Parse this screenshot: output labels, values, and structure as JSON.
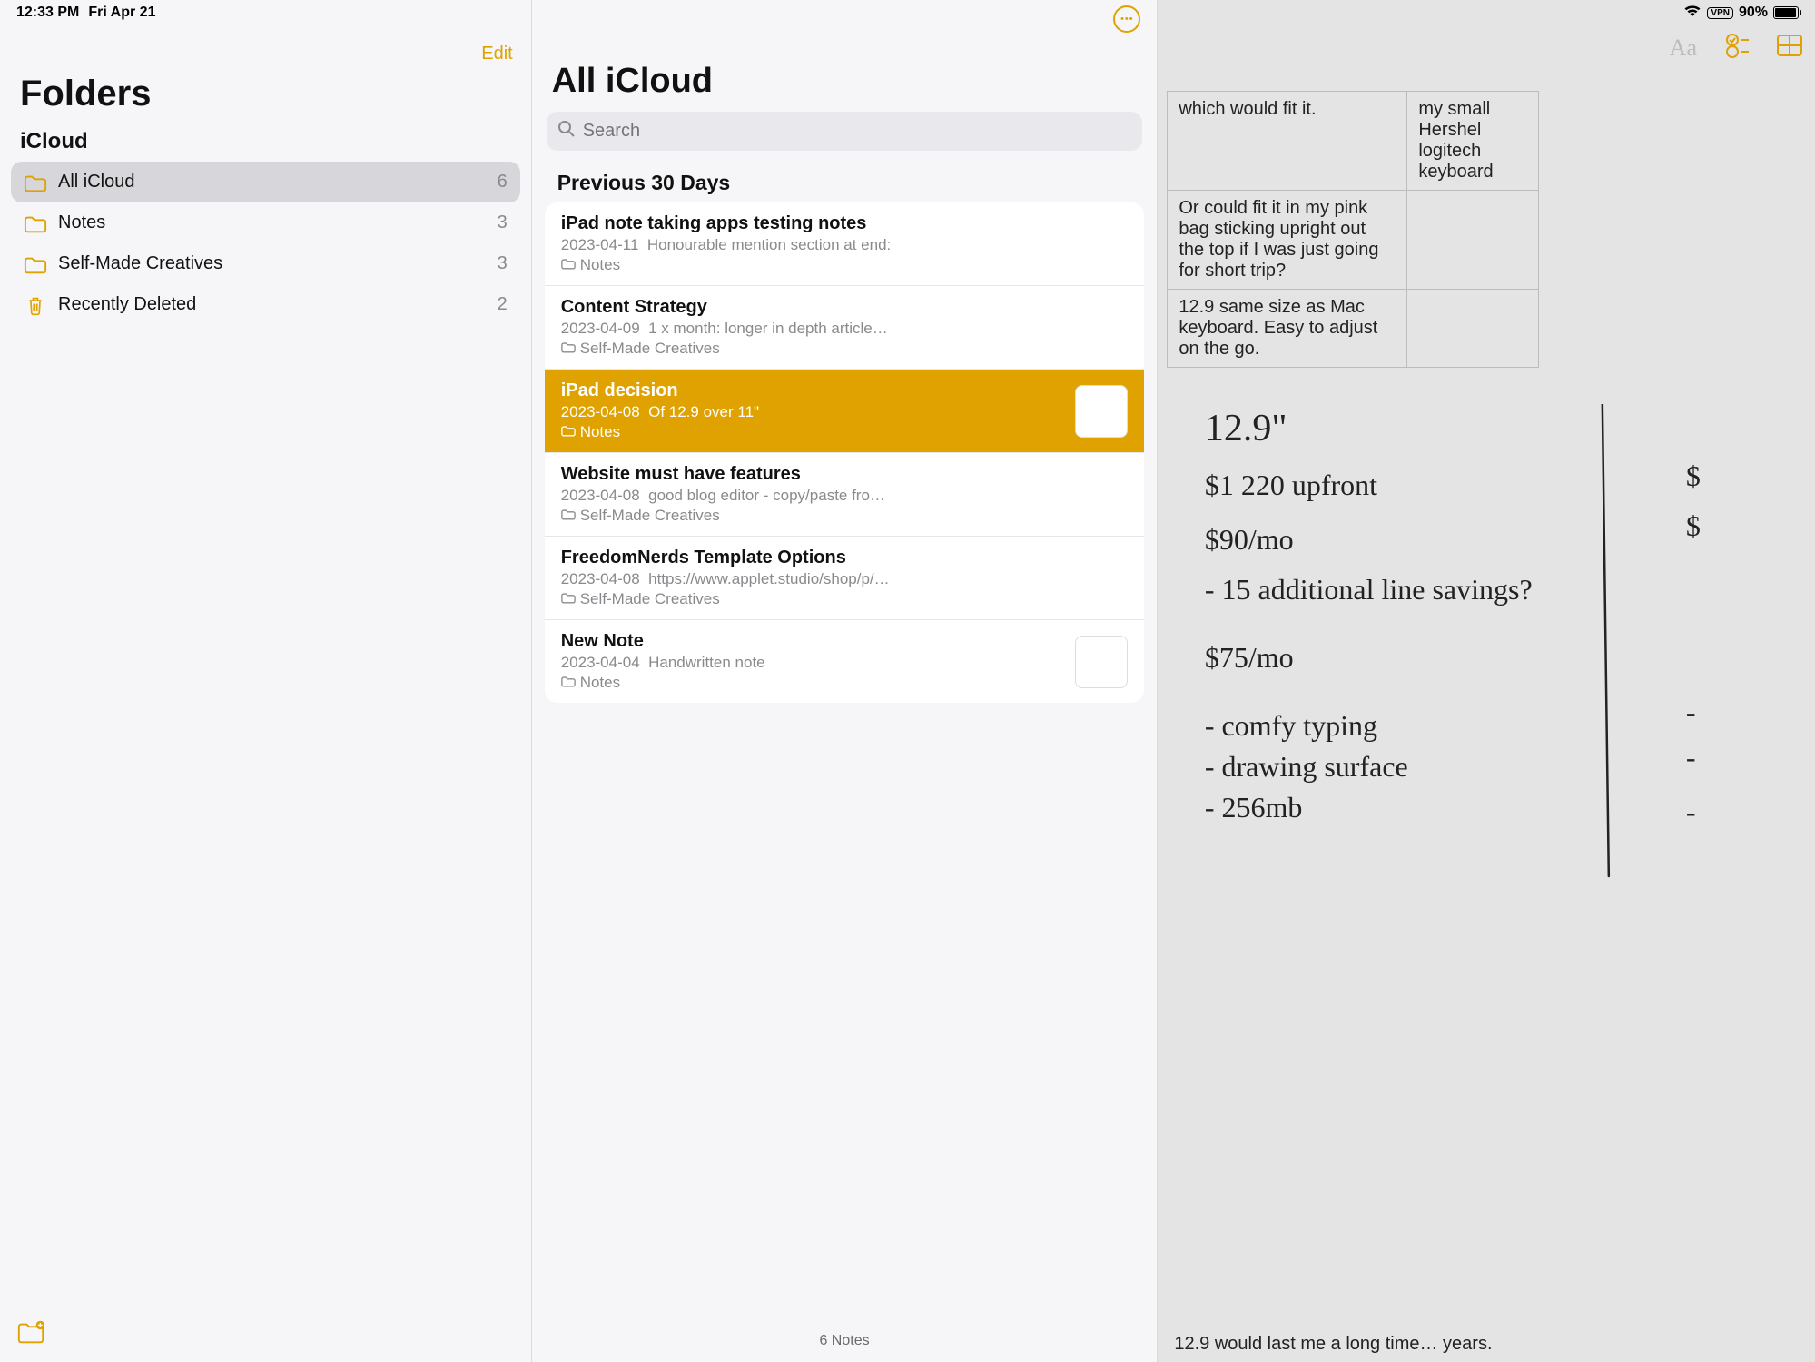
{
  "statusbar": {
    "time": "12:33 PM",
    "date": "Fri Apr 21",
    "vpn": "VPN",
    "battery_pct": "90%"
  },
  "folders": {
    "edit": "Edit",
    "title": "Folders",
    "section": "iCloud",
    "items": [
      {
        "label": "All iCloud",
        "count": "6",
        "selected": true,
        "icon": "folder"
      },
      {
        "label": "Notes",
        "count": "3",
        "selected": false,
        "icon": "folder"
      },
      {
        "label": "Self-Made Creatives",
        "count": "3",
        "selected": false,
        "icon": "folder"
      },
      {
        "label": "Recently Deleted",
        "count": "2",
        "selected": false,
        "icon": "trash"
      }
    ]
  },
  "notes": {
    "title": "All iCloud",
    "search_placeholder": "Search",
    "group": "Previous 30 Days",
    "items": [
      {
        "title": "iPad note taking apps testing notes",
        "date": "2023-04-11",
        "preview": "Honourable mention section at end:",
        "folder": "Notes",
        "selected": false,
        "thumb": false
      },
      {
        "title": "Content Strategy",
        "date": "2023-04-09",
        "preview": "1 x month: longer in depth article…",
        "folder": "Self-Made Creatives",
        "selected": false,
        "thumb": false
      },
      {
        "title": "iPad decision",
        "date": "2023-04-08",
        "preview": "Of 12.9 over 11\"",
        "folder": "Notes",
        "selected": true,
        "thumb": true
      },
      {
        "title": "Website must have features",
        "date": "2023-04-08",
        "preview": "good blog editor - copy/paste fro…",
        "folder": "Self-Made Creatives",
        "selected": false,
        "thumb": false
      },
      {
        "title": "FreedomNerds Template Options",
        "date": "2023-04-08",
        "preview": "https://www.applet.studio/shop/p/…",
        "folder": "Self-Made Creatives",
        "selected": false,
        "thumb": false
      },
      {
        "title": "New Note",
        "date": "2023-04-04",
        "preview": "Handwritten note",
        "folder": "Notes",
        "selected": false,
        "thumb": true
      }
    ],
    "footer": "6 Notes"
  },
  "detail": {
    "table_rows": [
      {
        "c0": "which would fit it.",
        "c1": "my small Hershel logitech keyboard"
      },
      {
        "c0": "Or could fit it in my pink bag sticking upright out the top if I was just going for short trip?",
        "c1": ""
      },
      {
        "c0": "12.9 same size as Mac keyboard. Easy to adjust on the go.",
        "c1": ""
      }
    ],
    "handwriting_lines": [
      "12.9\"",
      "$1 220 upfront",
      "$90/mo",
      " - 15 additional line savings?",
      "$75/mo",
      " - comfy typing",
      " - drawing surface",
      " - 256mb"
    ],
    "handwriting_right": [
      "$",
      "$",
      "-",
      "-",
      "-"
    ],
    "bottom": "12.9 would last me a long time… years."
  }
}
